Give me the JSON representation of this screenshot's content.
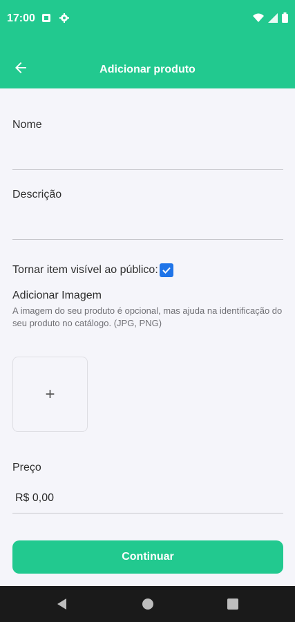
{
  "status_bar": {
    "time": "17:00",
    "left_icons": [
      "notification-square-icon",
      "gear-icon"
    ],
    "right_icons": [
      "wifi-icon",
      "signal-icon",
      "battery-icon"
    ]
  },
  "app_bar": {
    "back_icon": "arrow-left-icon",
    "title": "Adicionar produto"
  },
  "form": {
    "name": {
      "label": "Nome",
      "value": ""
    },
    "description": {
      "label": "Descrição",
      "value": ""
    },
    "visible": {
      "label": "Tornar item visível ao público:",
      "checked": true
    },
    "image": {
      "title": "Adicionar Imagem",
      "help": "A imagem do seu produto é opcional, mas ajuda na identificação do seu produto no catálogo. (JPG, PNG)",
      "add_symbol": "+"
    },
    "price": {
      "label": "Preço",
      "value": "R$ 0,00"
    }
  },
  "actions": {
    "continue_label": "Continuar"
  },
  "nav_bar": {
    "icons": [
      "nav-back-icon",
      "nav-home-icon",
      "nav-recents-icon"
    ]
  },
  "colors": {
    "primary": "#22c98f",
    "checkbox": "#1f74e8",
    "background": "#f5f5fa"
  }
}
